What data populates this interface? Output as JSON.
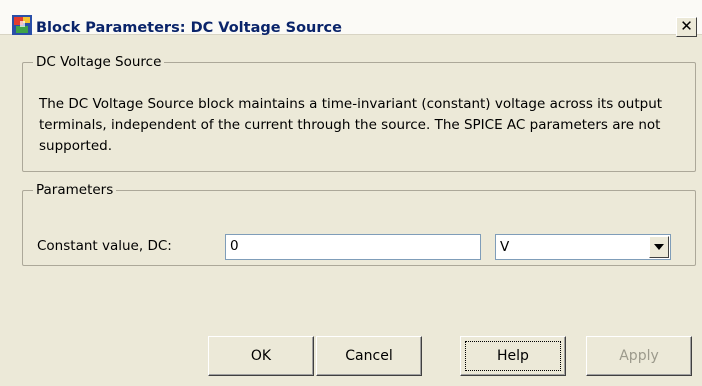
{
  "window": {
    "title": "Block Parameters: DC Voltage Source",
    "close_label": "✕"
  },
  "description_group": {
    "legend": "DC Voltage Source",
    "text": "The DC Voltage Source block maintains a time-invariant (constant) voltage across its output terminals, independent of the current through the source. The SPICE AC parameters are not supported."
  },
  "parameters_group": {
    "legend": "Parameters",
    "constant_value_label": "Constant value, DC:",
    "constant_value": "0",
    "unit_value": "V"
  },
  "buttons": {
    "ok": "OK",
    "cancel": "Cancel",
    "help": "Help",
    "apply": "Apply"
  },
  "icons": {
    "app": "simulink-block-icon",
    "close": "close-icon",
    "dropdown": "chevron-down-icon"
  },
  "colors": {
    "title_text": "#0a246a",
    "dialog_bg": "#ece9d8",
    "disabled_text": "#9c9a8c"
  }
}
